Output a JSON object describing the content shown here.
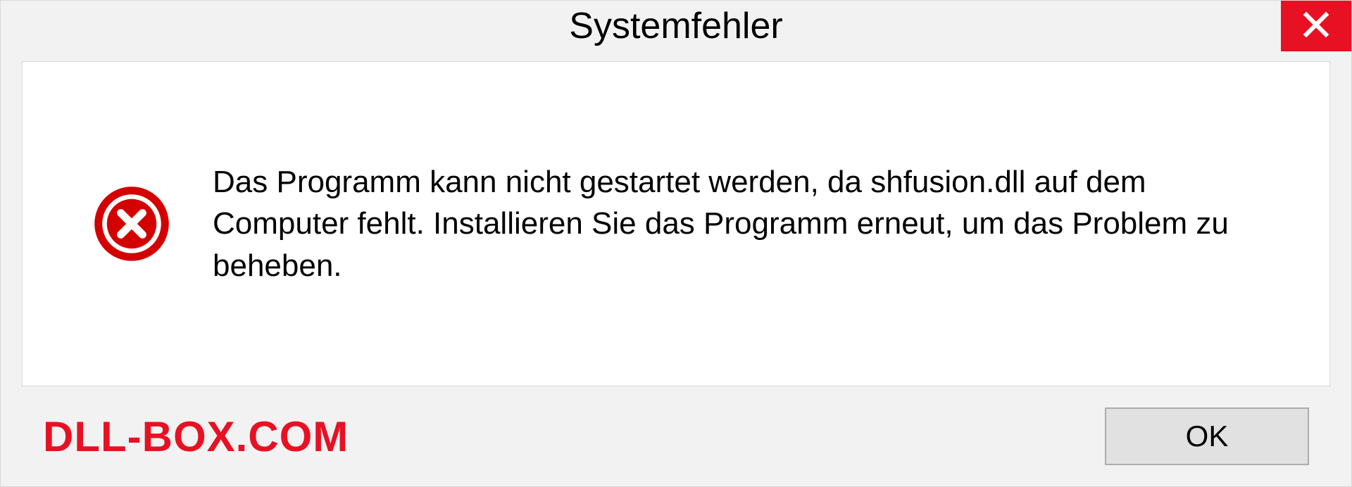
{
  "dialog": {
    "title": "Systemfehler",
    "message": "Das Programm kann nicht gestartet werden, da shfusion.dll auf dem Computer fehlt. Installieren Sie das Programm erneut, um das Problem zu beheben.",
    "ok_label": "OK"
  },
  "watermark": "DLL-BOX.COM",
  "colors": {
    "close_red": "#e81123",
    "error_red": "#d40000"
  }
}
